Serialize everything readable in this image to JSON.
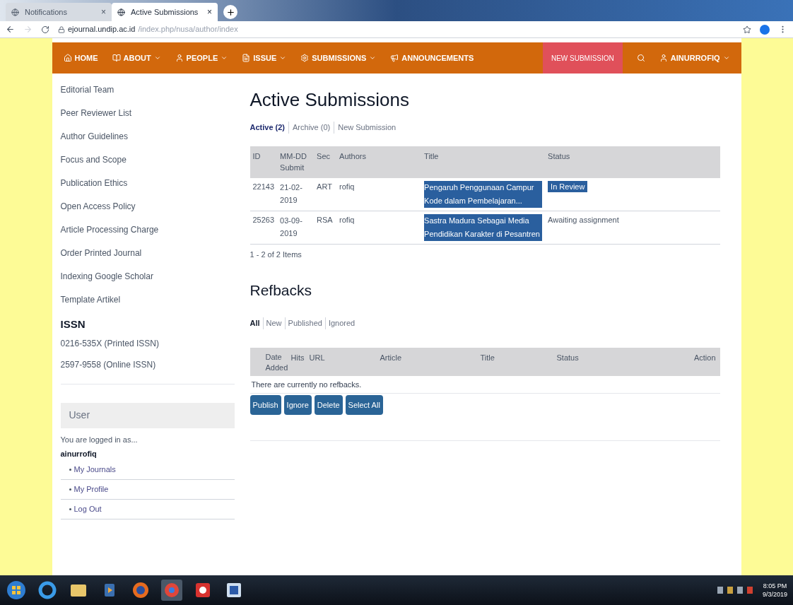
{
  "browser": {
    "tabs": [
      {
        "label": "Notifications",
        "close": "×",
        "selected": false
      },
      {
        "label": "Active Submissions",
        "close": "×",
        "selected": true
      }
    ],
    "url_host": "ejournal.undip.ac.id",
    "url_path": "/index.php/nusa/author/index"
  },
  "navbar": {
    "items": [
      {
        "label": "HOME",
        "dropdown": false
      },
      {
        "label": "ABOUT",
        "dropdown": true
      },
      {
        "label": "PEOPLE",
        "dropdown": true
      },
      {
        "label": "ISSUE",
        "dropdown": true
      },
      {
        "label": "SUBMISSIONS",
        "dropdown": true
      },
      {
        "label": "ANNOUNCEMENTS",
        "dropdown": false
      }
    ],
    "new_submission": "NEW SUBMISSION",
    "user": "AINURROFIQ"
  },
  "sidebar": {
    "links": [
      "Editorial Team",
      "Peer Reviewer List",
      "Author Guidelines",
      "Focus and Scope",
      "Publication Ethics",
      "Open Access Policy",
      "Article Processing Charge",
      "Order Printed Journal",
      "Indexing Google Scholar",
      "Template Artikel"
    ],
    "issn_heading": "ISSN",
    "issn": [
      "0216-535X (Printed ISSN)",
      "2597-9558 (Online ISSN)"
    ],
    "user_heading": "User",
    "logged_in": "You are logged in as...",
    "username": "ainurrofiq",
    "user_links": [
      "My Journals",
      "My Profile",
      "Log Out"
    ]
  },
  "submissions": {
    "title": "Active Submissions",
    "tabs": [
      {
        "label": "Active (2)",
        "selected": true
      },
      {
        "label": "Archive (0)",
        "selected": false
      },
      {
        "label": "New Submission",
        "selected": false
      }
    ],
    "columns": [
      "ID",
      "MM-DD Submit",
      "Sec",
      "Authors",
      "Title",
      "Status"
    ],
    "rows": [
      {
        "id": "22143",
        "date": "21-02-2019",
        "sec": "ART",
        "authors": "rofiq",
        "title": "Pengaruh Penggunaan Campur Kode dalam Pembelajaran...",
        "status": "In Review",
        "title_highlighted": true,
        "status_highlighted": true
      },
      {
        "id": "25263",
        "date": "03-09-2019",
        "sec": "RSA",
        "authors": "rofiq",
        "title": "Sastra Madura Sebagai Media Pendidikan Karakter di Pesantren",
        "status": "Awaiting assignment",
        "title_highlighted": true,
        "status_highlighted": false
      }
    ],
    "count": "1 - 2 of 2 Items"
  },
  "refbacks": {
    "title": "Refbacks",
    "filters": [
      {
        "label": "All",
        "selected": true
      },
      {
        "label": "New",
        "selected": false
      },
      {
        "label": "Published",
        "selected": false
      },
      {
        "label": "Ignored",
        "selected": false
      }
    ],
    "columns": [
      "Date Added",
      "Hits",
      "URL",
      "Article",
      "Title",
      "Status",
      "Action"
    ],
    "empty": "There are currently no refbacks.",
    "buttons": [
      "Publish",
      "Ignore",
      "Delete",
      "Select All"
    ]
  },
  "taskbar": {
    "time": "8:05 PM",
    "date": "9/3/2019"
  }
}
